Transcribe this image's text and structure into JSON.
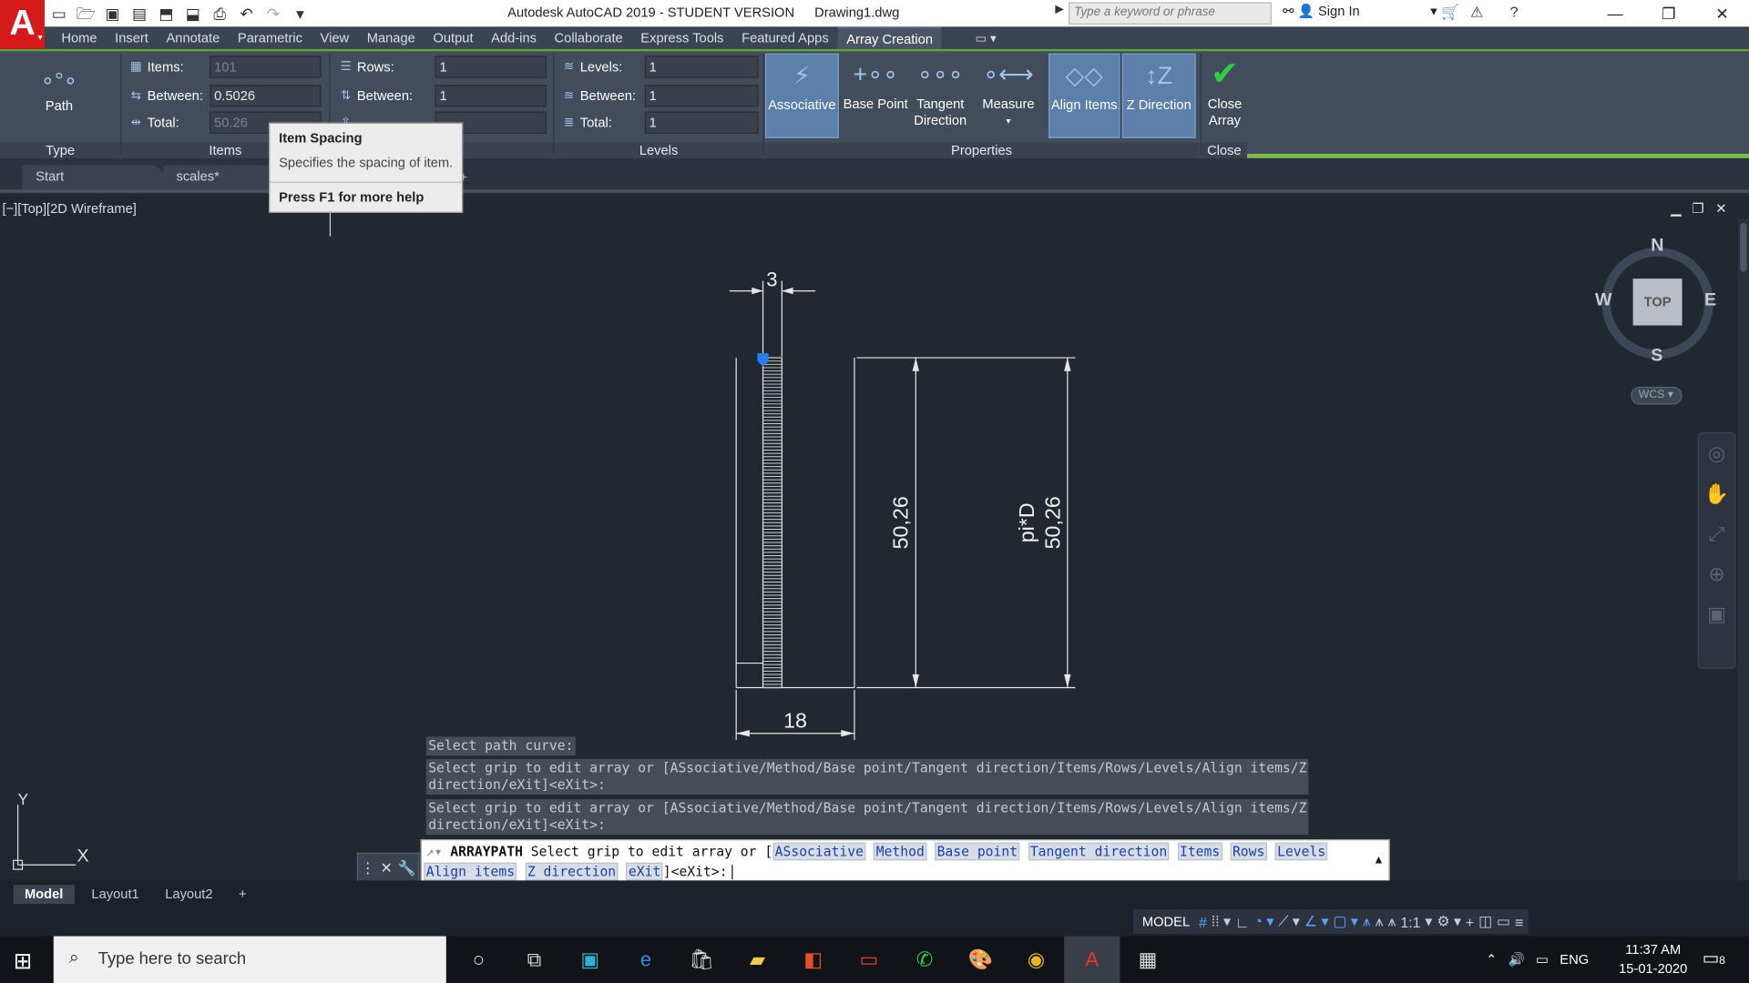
{
  "app": {
    "logo": "A",
    "title": "Autodesk AutoCAD 2019 - STUDENT VERSION",
    "document": "Drawing1.dwg",
    "search_placeholder": "Type a keyword or phrase",
    "signin": "Sign In"
  },
  "ribbon_tabs": [
    "Home",
    "Insert",
    "Annotate",
    "Parametric",
    "View",
    "Manage",
    "Output",
    "Add-ins",
    "Collaborate",
    "Express Tools",
    "Featured Apps",
    "Array Creation"
  ],
  "active_ribbon_tab": "Array Creation",
  "ribbon": {
    "type_panel": {
      "title": "Type",
      "path_label": "Path"
    },
    "items_panel": {
      "title": "Items",
      "items_label": "Items:",
      "items_value": "101",
      "between_label": "Between:",
      "between_value": "0.5026",
      "total_label": "Total:",
      "total_value": "50.26"
    },
    "rows_panel": {
      "rows_label": "Rows:",
      "rows_value": "1",
      "between_label": "Between:",
      "between_value": "1",
      "total_value": ""
    },
    "levels_panel": {
      "title": "Levels",
      "levels_label": "Levels:",
      "levels_value": "1",
      "between_label": "Between:",
      "between_value": "1",
      "total_label": "Total:",
      "total_value": "1"
    },
    "properties_panel": {
      "title": "Properties",
      "associative": "Associative",
      "base_point": "Base Point",
      "tangent_1": "Tangent",
      "tangent_2": "Direction",
      "measure": "Measure",
      "align_items": "Align Items",
      "z_direction": "Z Direction"
    },
    "close_panel": {
      "title": "Close",
      "close_1": "Close",
      "close_2": "Array"
    }
  },
  "tooltip": {
    "title": "Item Spacing",
    "description": "Specifies the spacing of item.",
    "help": "Press F1 for more help"
  },
  "file_tabs": [
    "Start",
    "scales*"
  ],
  "viewport_label": "[−][Top][2D Wireframe]",
  "drawing": {
    "dim_top": "3",
    "dim_height_1": "50,26",
    "dim_height_2_a": "pi*D",
    "dim_height_2_b": "50,26",
    "dim_bottom": "18"
  },
  "viewcube": {
    "n": "N",
    "s": "S",
    "e": "E",
    "w": "W",
    "top": "TOP",
    "wcs": "WCS"
  },
  "ucs": {
    "y": "Y",
    "x": "X"
  },
  "command_history": [
    "Select path curve:",
    "Select grip to edit array or [ASsociative/Method/Base point/Tangent direction/Items/Rows/Levels/Align items/Z\ndirection/eXit]<eXit>:",
    "Select grip to edit array or [ASsociative/Method/Base point/Tangent direction/Items/Rows/Levels/Align items/Z\ndirection/eXit]<eXit>:"
  ],
  "command_line": {
    "command": "ARRAYPATH",
    "prompt": "Select grip to edit array or [",
    "options": [
      "ASsociative",
      "Method",
      "Base point",
      "Tangent direction",
      "Items",
      "Rows",
      "Levels",
      "Align items",
      "Z direction",
      "eXit"
    ],
    "suffix": "]<eXit>:"
  },
  "layout_tabs": [
    "Model",
    "Layout1",
    "Layout2"
  ],
  "status": {
    "model": "MODEL",
    "scale": "1:1"
  },
  "taskbar": {
    "search_placeholder": "Type here to search",
    "language": "ENG",
    "time": "11:37 AM",
    "date": "15-01-2020",
    "notification_count": "8"
  }
}
